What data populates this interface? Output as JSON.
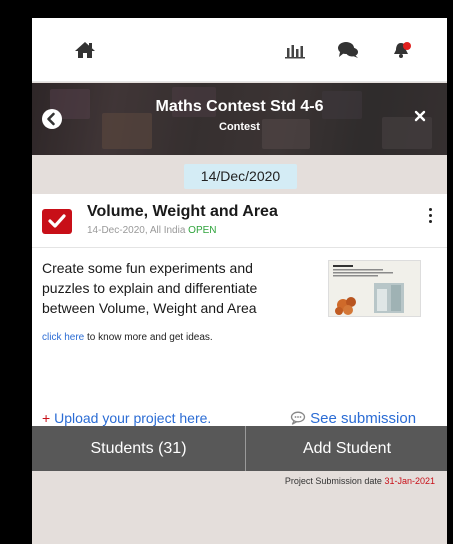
{
  "nav": {
    "icons": [
      "home-icon",
      "chart-icon",
      "chat-icon",
      "bell-icon"
    ]
  },
  "banner": {
    "title": "Maths Contest Std 4-6",
    "subtitle": "Contest"
  },
  "date_chip": "14/Dec/2020",
  "card": {
    "title": "Volume, Weight and Area",
    "meta": "14-Dec-2020, All India ",
    "status": "OPEN",
    "description": "Create some fun experiments and puzzles to explain and differentiate between Volume, Weight and Area",
    "more_link": "click here",
    "more_text": " to know more and get ideas.",
    "upload_plus": "+ ",
    "upload_label": "Upload your project here.",
    "see_submission": "See submission"
  },
  "buttons": {
    "students": "Students (31)",
    "add_student": "Add Student"
  },
  "submission": {
    "label": "Project Submission date ",
    "date": "31-Jan-2021"
  },
  "colors": {
    "accent_red": "#c80f18",
    "link_blue": "#2b6cd4",
    "open_green": "#2ea33b",
    "button_bg": "#585858",
    "page_bg": "#e4dedb"
  }
}
